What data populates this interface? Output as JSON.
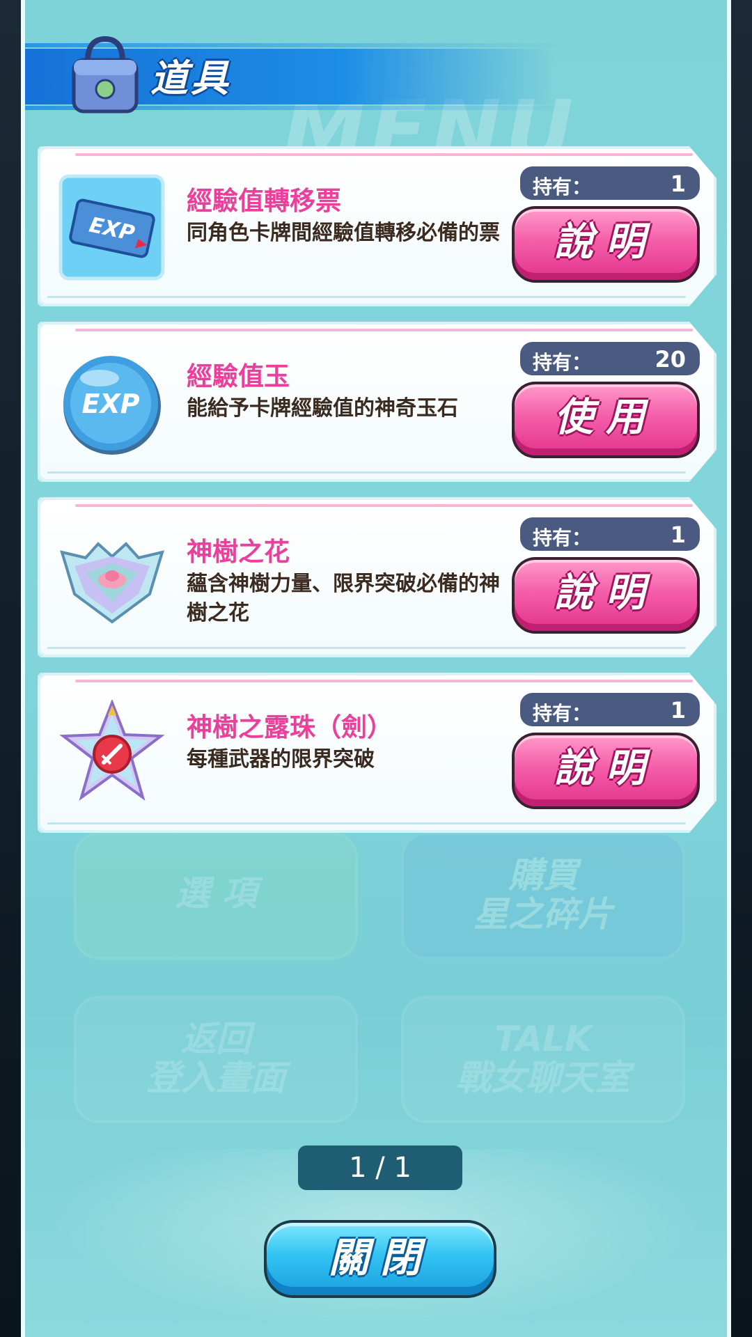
{
  "header": {
    "title": "道具"
  },
  "items": [
    {
      "name": "經驗值轉移票",
      "description": "同角色卡牌間經驗值轉移必備的票",
      "owned_label": "持有：",
      "owned_count": "1",
      "action_label": "說明",
      "icon": "exp-ticket-icon"
    },
    {
      "name": "經驗值玉",
      "description": "能給予卡牌經驗值的神奇玉石",
      "owned_label": "持有：",
      "owned_count": "20",
      "action_label": "使用",
      "icon": "exp-orb-icon"
    },
    {
      "name": "神樹之花",
      "description": "蘊含神樹力量、限界突破必備的神樹之花",
      "owned_label": "持有：",
      "owned_count": "1",
      "action_label": "說明",
      "icon": "sacred-tree-flower-icon"
    },
    {
      "name": "神樹之露珠（劍）",
      "description": "每種武器的限界突破",
      "owned_label": "持有：",
      "owned_count": "1",
      "action_label": "說明",
      "icon": "sword-dewdrop-icon"
    }
  ],
  "background_menu": {
    "title": "MENU",
    "tiles": [
      "選 項",
      "購買\n星之碎片",
      "返回\n登入畫面",
      "TALK\n戰女聊天室"
    ]
  },
  "pagination": {
    "text": "1 / 1"
  },
  "close_button": {
    "label": "關閉"
  },
  "colors": {
    "panel": "#7ed3d8",
    "accent_pink": "#ea3f9a",
    "action_pink": "#f55ea9",
    "close_blue": "#32c3f2",
    "header_blue": "#1672d8"
  }
}
